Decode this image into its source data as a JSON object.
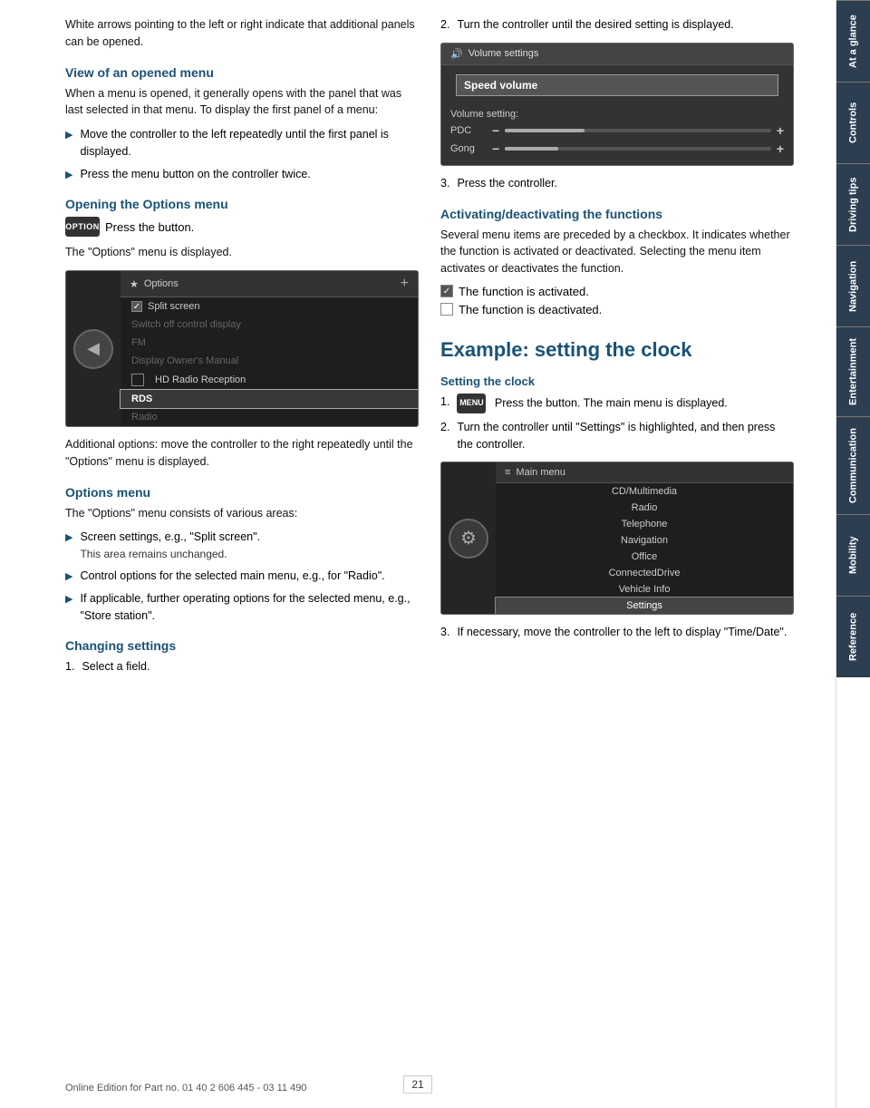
{
  "page": {
    "number": "21",
    "footer_text": "Online Edition for Part no. 01 40 2 606 445 - 03 11 490"
  },
  "sidebar": {
    "tabs": [
      {
        "label": "At a glance",
        "active": true
      },
      {
        "label": "Controls"
      },
      {
        "label": "Driving tips"
      },
      {
        "label": "Navigation"
      },
      {
        "label": "Entertainment"
      },
      {
        "label": "Communication"
      },
      {
        "label": "Mobility"
      },
      {
        "label": "Reference"
      }
    ]
  },
  "left_col": {
    "intro_text": "White arrows pointing to the left or right indicate that additional panels can be opened.",
    "section1": {
      "heading": "View of an opened menu",
      "body": "When a menu is opened, it generally opens with the panel that was last selected in that menu. To display the first panel of a menu:",
      "bullets": [
        "Move the controller to the left repeatedly until the first panel is displayed.",
        "Press the menu button on the controller twice."
      ]
    },
    "section2": {
      "heading": "Opening the Options menu",
      "option_btn_label": "OPTION",
      "option_instruction": "Press the button.",
      "result_text": "The \"Options\" menu is displayed.",
      "options_screen": {
        "title_icon": "★",
        "title": "Options",
        "items": [
          {
            "text": "Split screen",
            "type": "checked",
            "check": "✓"
          },
          {
            "text": "Switch off control display",
            "type": "indent"
          },
          {
            "text": "FM",
            "type": "section"
          },
          {
            "text": "Display Owner's Manual",
            "type": "indent"
          },
          {
            "text": "HD Radio Reception",
            "type": "checkbox"
          },
          {
            "text": "RDS",
            "type": "selected"
          },
          {
            "text": "Radio",
            "type": "dimmed"
          }
        ],
        "plus_label": "+"
      },
      "additional_text": "Additional options: move the controller to the right repeatedly until the \"Options\" menu is displayed."
    },
    "section3": {
      "heading": "Options menu",
      "body": "The \"Options\" menu consists of various areas:",
      "bullets": [
        {
          "text": "Screen settings, e.g., \"Split screen\".",
          "sub": "This area remains unchanged."
        },
        {
          "text": "Control options for the selected main menu, e.g., for \"Radio\"."
        },
        {
          "text": "If applicable, further operating options for the selected menu, e.g., \"Store station\"."
        }
      ]
    },
    "section4": {
      "heading": "Changing settings",
      "step1": "Select a field."
    }
  },
  "right_col": {
    "step2": {
      "text": "Turn the controller until the desired setting is displayed.",
      "vol_screen": {
        "title_icon": "🔊",
        "title": "Volume settings",
        "selected_item": "Speed volume",
        "setting_label": "Volume setting:",
        "sliders": [
          {
            "label": "PDC",
            "fill": 30
          },
          {
            "label": "Gong",
            "fill": 20
          }
        ]
      }
    },
    "step3": {
      "text": "Press the controller."
    },
    "section_activating": {
      "heading": "Activating/deactivating the functions",
      "body": "Several menu items are preceded by a checkbox. It indicates whether the function is activated or deactivated. Selecting the menu item activates or deactivates the function.",
      "activated_label": "The function is activated.",
      "deactivated_label": "The function is deactivated."
    },
    "section_example": {
      "heading_large": "Example: setting the clock",
      "heading_sub": "Setting the clock",
      "step1": {
        "btn_label": "MENU",
        "text": "Press the button. The main menu is displayed."
      },
      "step2": {
        "text": "Turn the controller until \"Settings\" is highlighted, and then press the controller."
      },
      "main_menu_screen": {
        "title_icon": "≡",
        "title": "Main menu",
        "items": [
          "CD/Multimedia",
          "Radio",
          "Telephone",
          "Navigation",
          "Office",
          "ConnectedDrive",
          "Vehicle Info",
          "Settings"
        ],
        "highlighted": "Settings"
      },
      "step3": {
        "text": "If necessary, move the controller to the left to display \"Time/Date\"."
      }
    }
  }
}
